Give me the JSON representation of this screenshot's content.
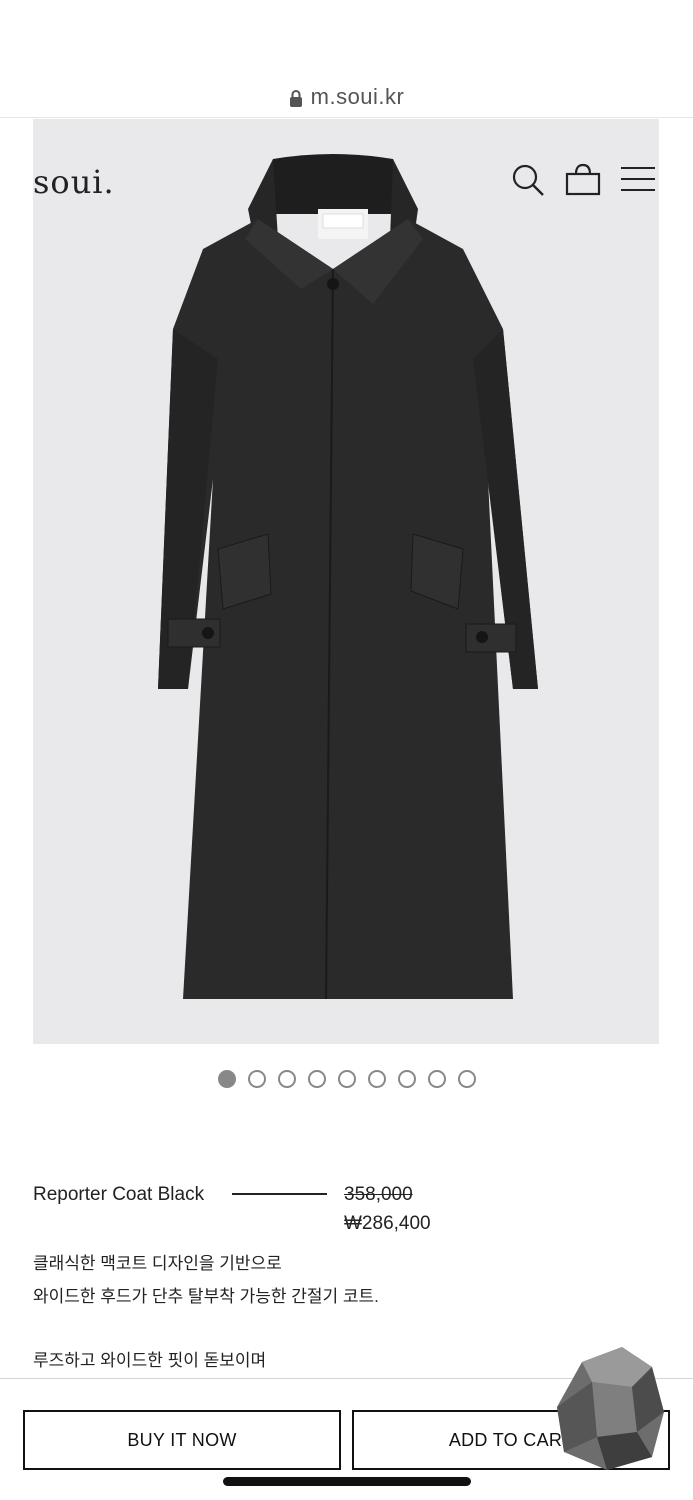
{
  "browser": {
    "url": "m.soui.kr"
  },
  "header": {
    "logo": "soui."
  },
  "product": {
    "image_label_tag": "mediumwgrey",
    "image_count": 9,
    "active_image_index": 0,
    "title": "Reporter Coat Black",
    "price_original": "358,000",
    "price_sale": "₩286,400",
    "description_lines": [
      "클래식한 맥코트 디자인을 기반으로",
      "와이드한 후드가 단추 탈부착 가능한 간절기 코트.",
      "",
      "루즈하고 와이드한 핏이 돋보이며"
    ]
  },
  "actions": {
    "buy_now": "BUY IT NOW",
    "add_to_cart": "ADD TO CART"
  },
  "colors": {
    "hero_bg": "#e9e9ec",
    "coat": "#2a2a2a",
    "dot": "#888888"
  },
  "icons": [
    "lock-icon",
    "search-icon",
    "bag-icon",
    "menu-icon"
  ]
}
